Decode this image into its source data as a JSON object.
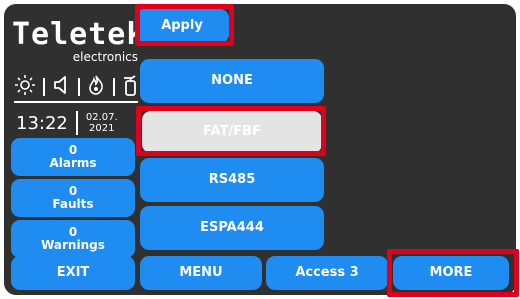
{
  "logo": {
    "brand": "Teletek",
    "sub": "electronics"
  },
  "status_icons": [
    "sun-icon",
    "speaker-icon",
    "flame-icon",
    "extinguisher-icon"
  ],
  "clock": {
    "time": "13:22",
    "date_day": "02.07.",
    "date_year": "2021"
  },
  "apply_label": "Apply",
  "options": [
    {
      "label": "NONE",
      "selected": false
    },
    {
      "label": "FAT/FBF",
      "selected": true
    },
    {
      "label": "RS485",
      "selected": false
    },
    {
      "label": "ESPA444",
      "selected": false
    }
  ],
  "counters": [
    {
      "count": "0",
      "label": "Alarms"
    },
    {
      "count": "0",
      "label": "Faults"
    },
    {
      "count": "0",
      "label": "Warnings"
    }
  ],
  "bottom": {
    "exit": "EXIT",
    "menu": "MENU",
    "access": "Access 3",
    "more": "MORE"
  },
  "colors": {
    "button": "#1e8cf0",
    "selected": "#e4e4e4",
    "panel": "#303030",
    "highlight": "#e0001b"
  }
}
